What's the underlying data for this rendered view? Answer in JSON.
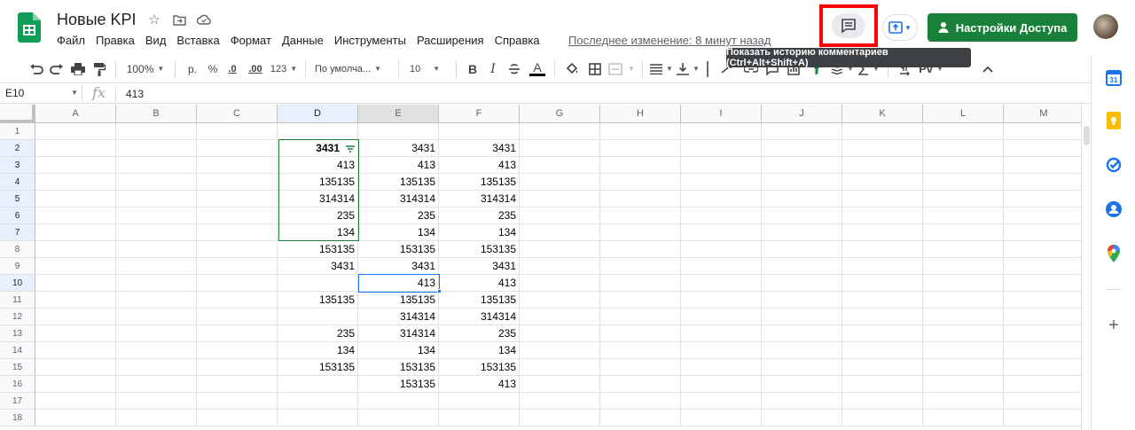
{
  "header": {
    "doc_title": "Новые KPI",
    "menu": [
      "Файл",
      "Правка",
      "Вид",
      "Вставка",
      "Формат",
      "Данные",
      "Инструменты",
      "Расширения",
      "Справка"
    ],
    "last_edit": "Последнее изменение: 8 минут назад",
    "share_label": "Настройки Доступа",
    "tooltip": "Показать историю комментариев (Ctrl+Alt+Shift+A)",
    "icons": {
      "star": "star-icon",
      "move": "move-to-folder-icon",
      "cloud": "cloud-status-icon",
      "comments": "comment-history-icon",
      "present": "present-icon"
    },
    "colors": {
      "share_bg": "#188038",
      "highlight": "#ff0000"
    }
  },
  "toolbar": {
    "zoom": "100%",
    "currency": "р.",
    "percent": "%",
    "dec_less": ".0",
    "dec_more": ".00",
    "more_formats": "123",
    "font": "По умолча...",
    "font_size": "10",
    "bold": "B",
    "italic": "I",
    "text_color": "A",
    "input_tools": "Pv"
  },
  "formula_bar": {
    "cell_ref": "E10",
    "fx": "fx",
    "value": "413"
  },
  "grid": {
    "columns": [
      "A",
      "B",
      "C",
      "D",
      "E",
      "F",
      "G",
      "H",
      "I",
      "J",
      "K",
      "L",
      "M"
    ],
    "rows": [
      "1",
      "2",
      "3",
      "4",
      "5",
      "6",
      "7",
      "8",
      "9",
      "10",
      "11",
      "12",
      "13",
      "14",
      "15",
      "16",
      "17",
      "18"
    ],
    "data": {
      "D": [
        "",
        "3431",
        "413",
        "135135",
        "314314",
        "235",
        "134",
        "153135",
        "3431",
        "",
        "135135",
        "",
        "235",
        "134",
        "153135",
        "",
        "",
        ""
      ],
      "E": [
        "",
        "3431",
        "413",
        "135135",
        "314314",
        "235",
        "134",
        "153135",
        "3431",
        "413",
        "135135",
        "314314",
        "314314",
        "134",
        "153135",
        "153135",
        "",
        ""
      ],
      "F": [
        "",
        "3431",
        "413",
        "135135",
        "314314",
        "235",
        "134",
        "153135",
        "3431",
        "413",
        "135135",
        "314314",
        "235",
        "134",
        "153135",
        "413",
        "",
        ""
      ]
    },
    "active_cell": "E10",
    "filter_range": "D2:D7"
  }
}
